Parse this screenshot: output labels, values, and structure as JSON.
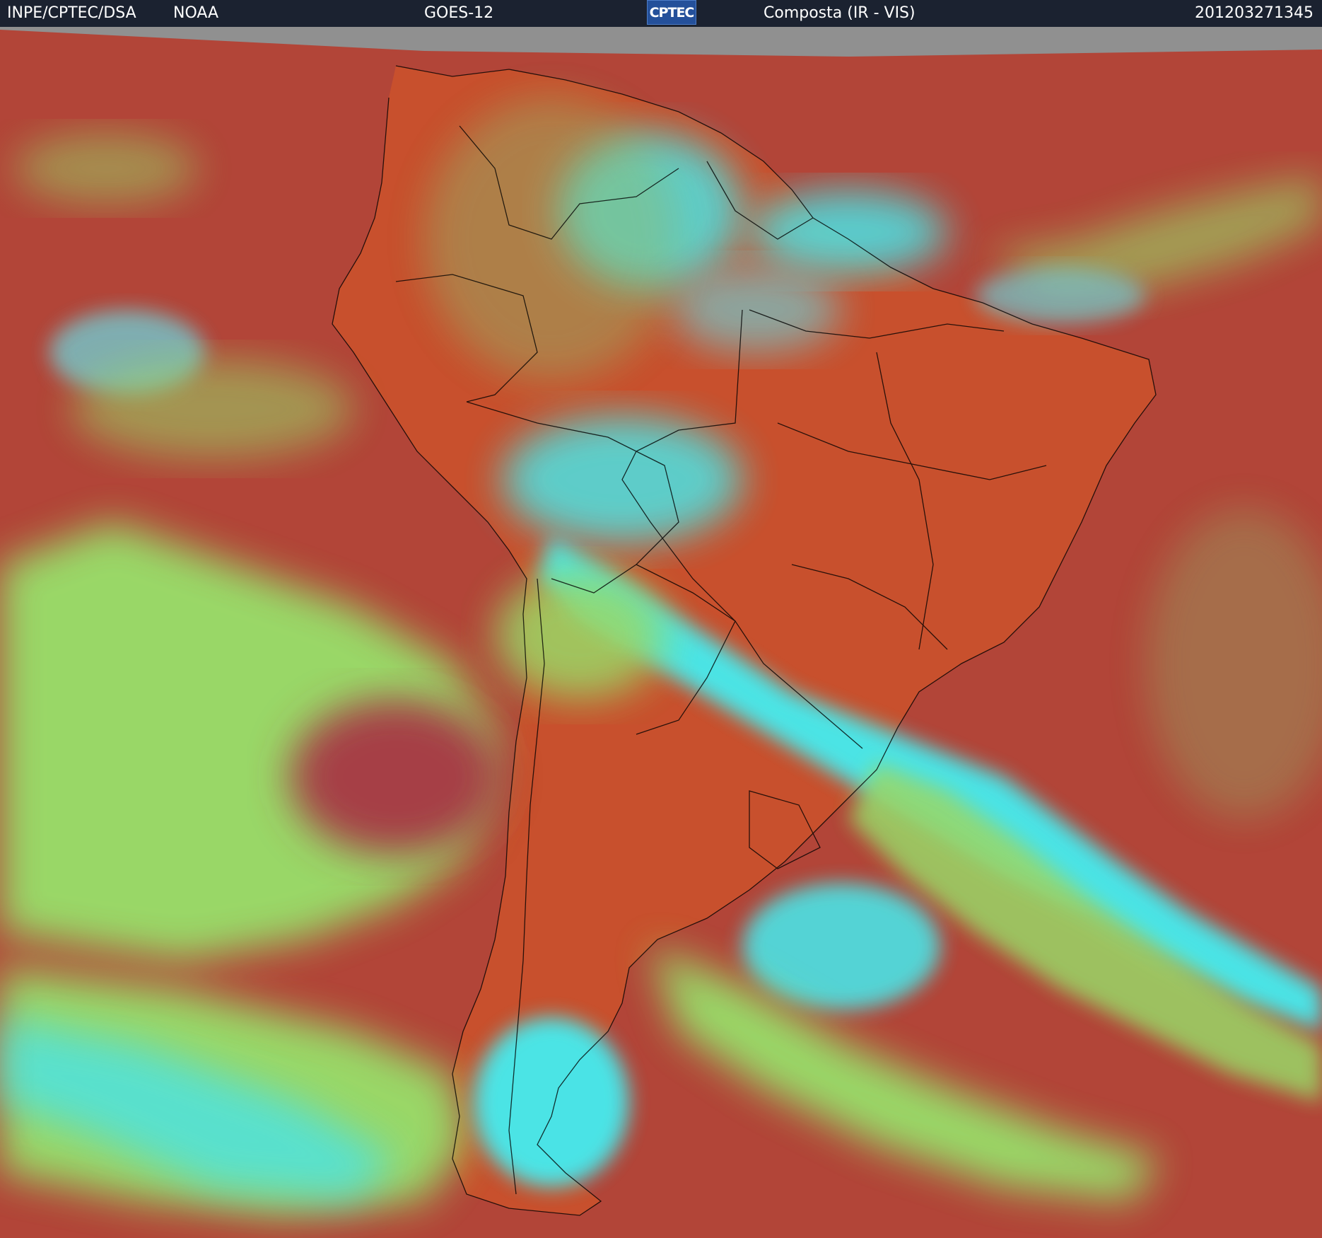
{
  "header": {
    "org": "INPE/CPTEC/DSA",
    "agency": "NOAA",
    "satellite": "GOES-12",
    "logo_text": "CPTEC",
    "product": "Composta (IR - VIS)",
    "timestamp": "201203271345"
  },
  "colors": {
    "header_bg": "#1b2230",
    "ocean_clear": "#b24538",
    "land_clear": "#c8502d",
    "low_cloud": "#98e06a",
    "high_cloud": "#45ecf0",
    "no_data": "#909090",
    "borders": "#000000"
  }
}
